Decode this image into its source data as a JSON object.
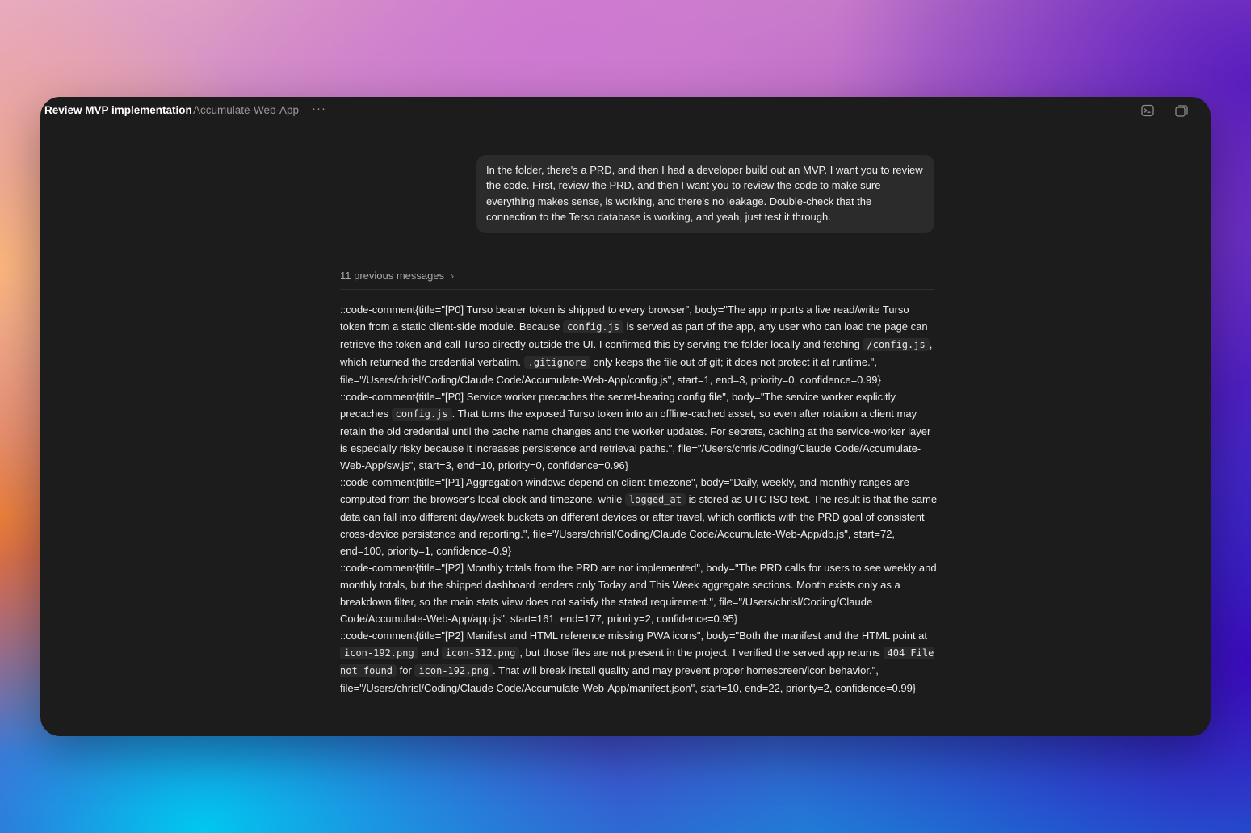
{
  "window": {
    "title": "Review MVP implementation",
    "project": "Accumulate-Web-App",
    "more_label": "···",
    "icons": [
      "terminal-icon",
      "windows-icon"
    ]
  },
  "user_message": "In the folder, there's a PRD, and then I had a developer build out an MVP. I want you to review the code. First, review the PRD, and then I want you to review the code to make sure everything makes sense, is working, and there's no leakage. Double-check that the connection to the Terso database is working, and yeah, just test it through.",
  "previous_messages": {
    "label": "11 previous messages",
    "chevron": "›"
  },
  "comments": [
    {
      "segments": [
        "::code-comment{title=\"[P0] Turso bearer token is shipped to every browser\", body=\"The app imports a live read/write Turso token from a static client-side module. Because ",
        "config.js",
        " is served as part of the app, any user who can load the page can retrieve the token and call Turso directly outside the UI. I confirmed this by serving the folder locally and fetching ",
        "/config.js",
        ", which returned the credential verbatim. ",
        ".gitignore",
        " only keeps the file out of git; it does not protect it at runtime.\", file=\"/Users/chrisl/Coding/Claude Code/Accumulate-Web-App/config.js\", start=1, end=3, priority=0, confidence=0.99}"
      ]
    },
    {
      "segments": [
        "::code-comment{title=\"[P0] Service worker precaches the secret-bearing config file\", body=\"The service worker explicitly precaches ",
        "config.js",
        ". That turns the exposed Turso token into an offline-cached asset, so even after rotation a client may retain the old credential until the cache name changes and the worker updates. For secrets, caching at the service-worker layer is especially risky because it increases persistence and retrieval paths.\", file=\"/Users/chrisl/Coding/Claude Code/Accumulate-Web-App/sw.js\", start=3, end=10, priority=0, confidence=0.96}"
      ]
    },
    {
      "segments": [
        "::code-comment{title=\"[P1] Aggregation windows depend on client timezone\", body=\"Daily, weekly, and monthly ranges are computed from the browser's local clock and timezone, while ",
        "logged_at",
        " is stored as UTC ISO text. The result is that the same data can fall into different day/week buckets on different devices or after travel, which conflicts with the PRD goal of consistent cross-device persistence and reporting.\", file=\"/Users/chrisl/Coding/Claude Code/Accumulate-Web-App/db.js\", start=72, end=100, priority=1, confidence=0.9}"
      ]
    },
    {
      "segments": [
        "::code-comment{title=\"[P2] Monthly totals from the PRD are not implemented\", body=\"The PRD calls for users to see weekly and monthly totals, but the shipped dashboard renders only Today and This Week aggregate sections. Month exists only as a breakdown filter, so the main stats view does not satisfy the stated requirement.\", file=\"/Users/chrisl/Coding/Claude Code/Accumulate-Web-App/app.js\", start=161, end=177, priority=2, confidence=0.95}"
      ]
    },
    {
      "segments": [
        "::code-comment{title=\"[P2] Manifest and HTML reference missing PWA icons\", body=\"Both the manifest and the HTML point at ",
        "icon-192.png",
        " and ",
        "icon-512.png",
        ", but those files are not present in the project. I verified the served app returns ",
        "404 File not found",
        " for ",
        "icon-192.png",
        ". That will break install quality and may prevent proper homescreen/icon behavior.\", file=\"/Users/chrisl/Coding/Claude Code/Accumulate-Web-App/manifest.json\", start=10, end=22, priority=2, confidence=0.99}"
      ]
    }
  ]
}
